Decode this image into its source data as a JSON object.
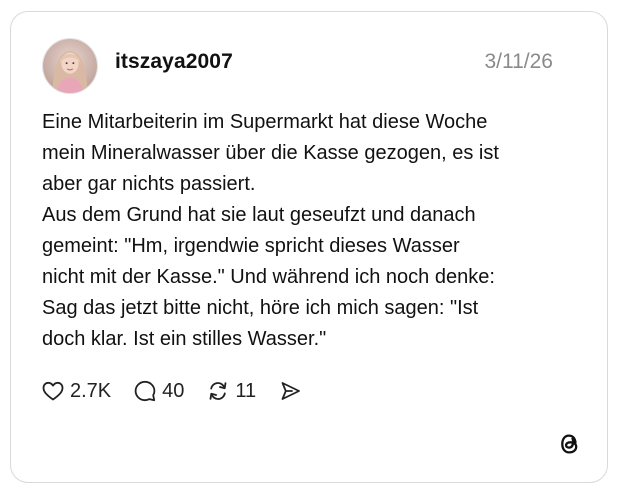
{
  "post": {
    "username": "itszaya2007",
    "date": "3/11/26",
    "text": "Eine Mitarbeiterin im Supermarkt hat diese Woche\nmein Mineralwasser über die Kasse gezogen, es ist\naber gar nichts passiert.\nAus dem Grund hat sie laut geseufzt und danach\ngemeint: \"Hm, irgendwie spricht dieses Wasser\nnicht mit der Kasse.\" Und während ich noch denke:\nSag das jetzt bitte nicht, höre ich mich sagen: \"Ist\ndoch klar. Ist ein stilles Wasser.\""
  },
  "actions": {
    "likes": "2.7K",
    "comments": "40",
    "reposts": "11"
  },
  "icons": [
    "avatar",
    "heart-icon",
    "comment-icon",
    "repost-icon",
    "share-icon",
    "threads-logo-icon"
  ]
}
